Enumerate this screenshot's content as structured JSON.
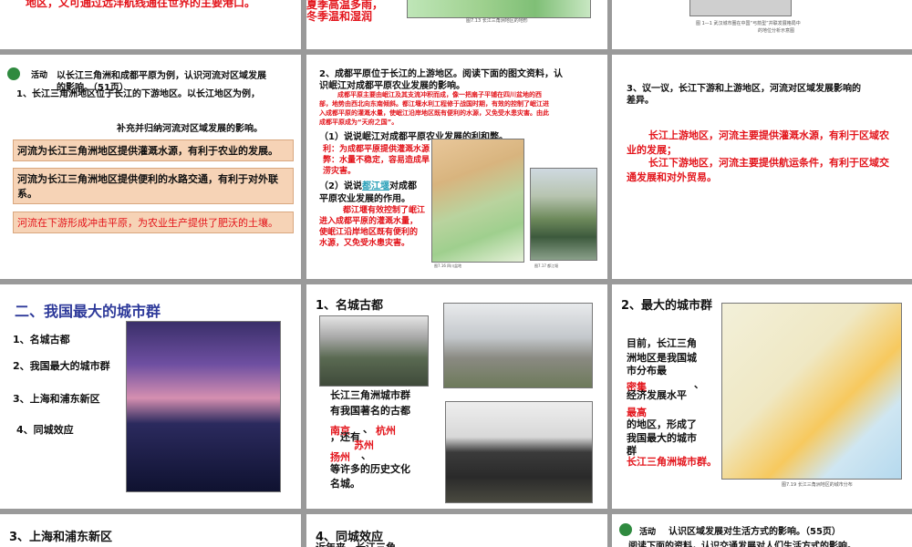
{
  "row1": {
    "s1_text": "地区，又可通过远洋航线通往世界的主要港口。",
    "s2_text1": "夏季高温多雨，",
    "s2_text2": "冬季温和湿润",
    "s2_caption": "图7.13 长江三角洲地区的地形",
    "s3_caption1": "图 1—1 武汉城市圈在中国“弓箭型”并联发展格局中",
    "s3_caption2": "的地位分析示意图"
  },
  "slide4": {
    "activity_label": "活动",
    "line1": "以长江三角洲和成都平原为例，认识河流对区域发展",
    "line2": "的影响。（51页）",
    "line3": "1、长江三角洲地区位于长江的下游地区。以长江地区为例，",
    "line4": "补充并归纳河流对区域发展的影响。",
    "box1": "河流为长江三角洲地区提供灌溉水源，有利于农业的发展。",
    "box2": "河流为长江三角洲地区提供便利的水路交通，有利于对外联系。",
    "box3": "河流在下游形成冲击平原，为农业生产提供了肥沃的土壤。"
  },
  "slide5": {
    "line1": "2、成都平原位于长江的上游地区。阅读下面的图文资料，认",
    "line2": "识岷江对成都平原农业发展的影响。",
    "para1": "成都平原主要由岷江及其支流冲积而成，像一把扇子平铺在四川盆地的西",
    "para2": "部，地势由西北向东南倾斜。都江堰水利工程修于战国时期，有效的控制了岷江进",
    "para3": "入成都平原的灌溉水量，使岷江沿岸地区既有便利的水源，又免受水患灾害。由此",
    "para4": "成都平原成为“天府之国”。",
    "q1": "（1）说说岷江对成都平原农业发展的利和弊。",
    "a1_1": "利：为成都平原提供灌溉水源",
    "a1_2": "弊：水量不稳定，容易造成旱",
    "a1_3": "涝灾害。",
    "q2a": "（2）说说",
    "q2link": "都江堰",
    "q2b": "对成都",
    "q2c": "平原农业发展的作用。",
    "a2_1": "都江堰有效控制了岷江",
    "a2_2": "进入成都平原的灌溉水量，",
    "a2_3": "使岷江沿岸地区既有便利的",
    "a2_4": "水源，又免受水患灾害。",
    "cap1": "图7.16 四川盆地",
    "cap2": "图7.17 都江堰"
  },
  "slide6": {
    "q1": "3、议一议，长江下游和上游地区，河流对区域发展影响的",
    "q2": "差异。",
    "a1": "长江上游地区，河流主要提供灌溉水源，有利于区域农",
    "a2": "业的发展；",
    "a3": "长江下游地区，河流主要提供航运条件，有利于区域交",
    "a4": "通发展和对外贸易。"
  },
  "slide7": {
    "title": "二、我国最大的城市群",
    "items": [
      "1、名城古都",
      "2、我国最大的城市群",
      "3、上海和浦东新区",
      "4、同城效应"
    ]
  },
  "slide8": {
    "title": "1、名城古都",
    "t1": "长江三角洲城市群",
    "t2": "有我国著名的古都",
    "t3": "、",
    "t4": "，还有",
    "t5": "、",
    "t6": "等许多的历史文化",
    "t7": "名城。",
    "a_nanjing": "南京",
    "a_hangzhou": "杭州",
    "a_suzhou": "苏州",
    "a_yangzhou": "扬州"
  },
  "slide9": {
    "title": "2、最大的城市群",
    "t1": "目前，长江三角",
    "t2": "洲地区是我国城",
    "t3": "市分布最",
    "t4": "、",
    "t5": "经济发展水平",
    "t6": "的地区，形成了",
    "t7": "我国最大的城市",
    "t8": "群",
    "a_dense": "密集",
    "a_high": "最高",
    "a_group": "长江三角洲城市群。",
    "map_caption": "图7.19 长江三角洲地区的城市分布"
  },
  "row4": {
    "s10_title": "3、上海和浦东新区",
    "s11_title": "4、同城效应",
    "s11_sub": "近年来，长江三角",
    "s12_label": "活动",
    "s12_line1": "认识区域发展对生活方式的影响。（55页）",
    "s12_line2": "阅读下面的资料，认识交通发展对人们生活方式的影响。"
  }
}
